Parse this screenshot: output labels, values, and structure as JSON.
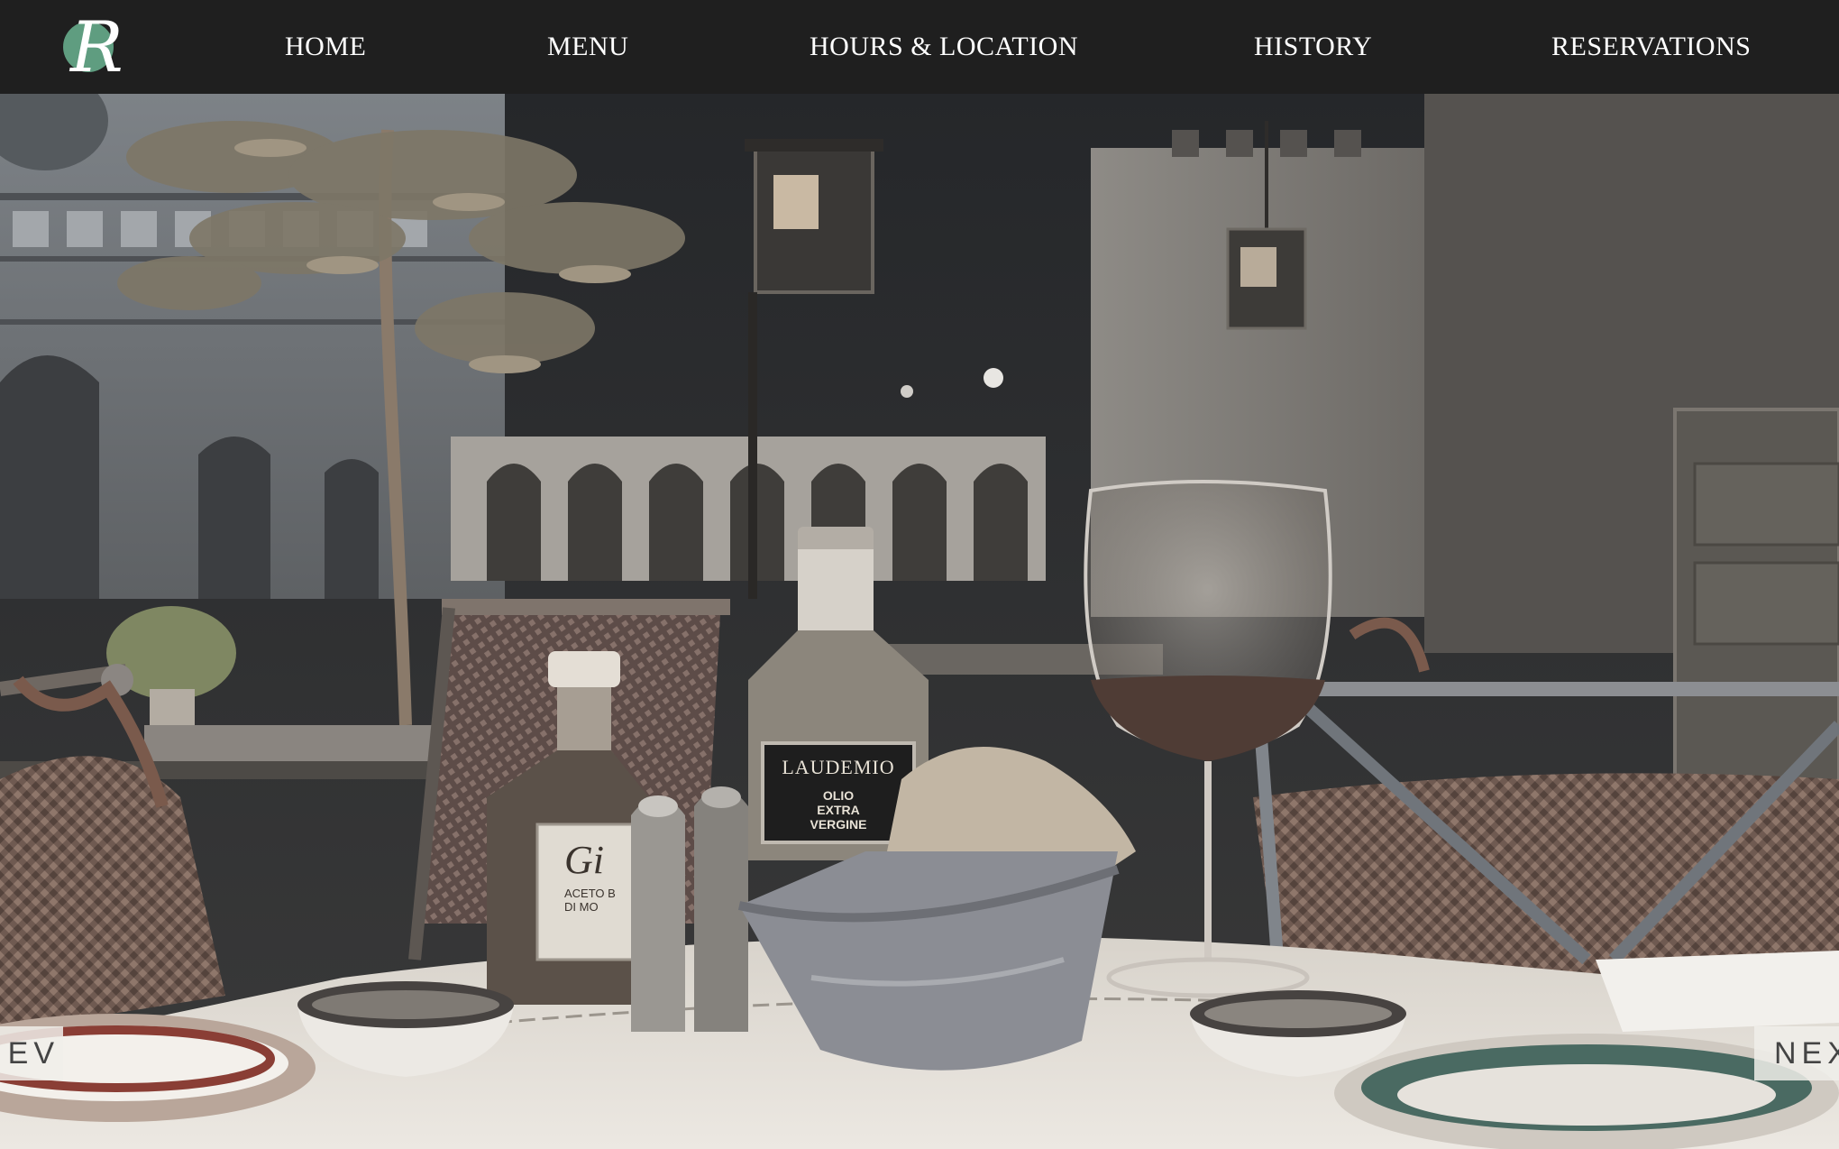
{
  "nav": {
    "logo_letter": "R",
    "logo_color": "#5f9d80",
    "items": [
      {
        "label": "HOME"
      },
      {
        "label": "MENU"
      },
      {
        "label": "HOURS & LOCATION"
      },
      {
        "label": "HISTORY"
      },
      {
        "label": "RESERVATIONS"
      }
    ]
  },
  "hero": {
    "bottle_label_brand": "LAUDEMIO",
    "bottle_label_line1": "OLIO",
    "bottle_label_line2": "EXTRA",
    "bottle_label_line3": "VERGINE",
    "small_bottle_label": "Gi",
    "small_bottle_sub1": "ACETO B",
    "small_bottle_sub2": "DI MO"
  },
  "slider": {
    "prev_label": "EV",
    "next_label": "NEX"
  },
  "colors": {
    "nav_background": "#1f1f1f",
    "nav_text": "#ffffff",
    "slider_button_bg": "#f0eeea"
  }
}
